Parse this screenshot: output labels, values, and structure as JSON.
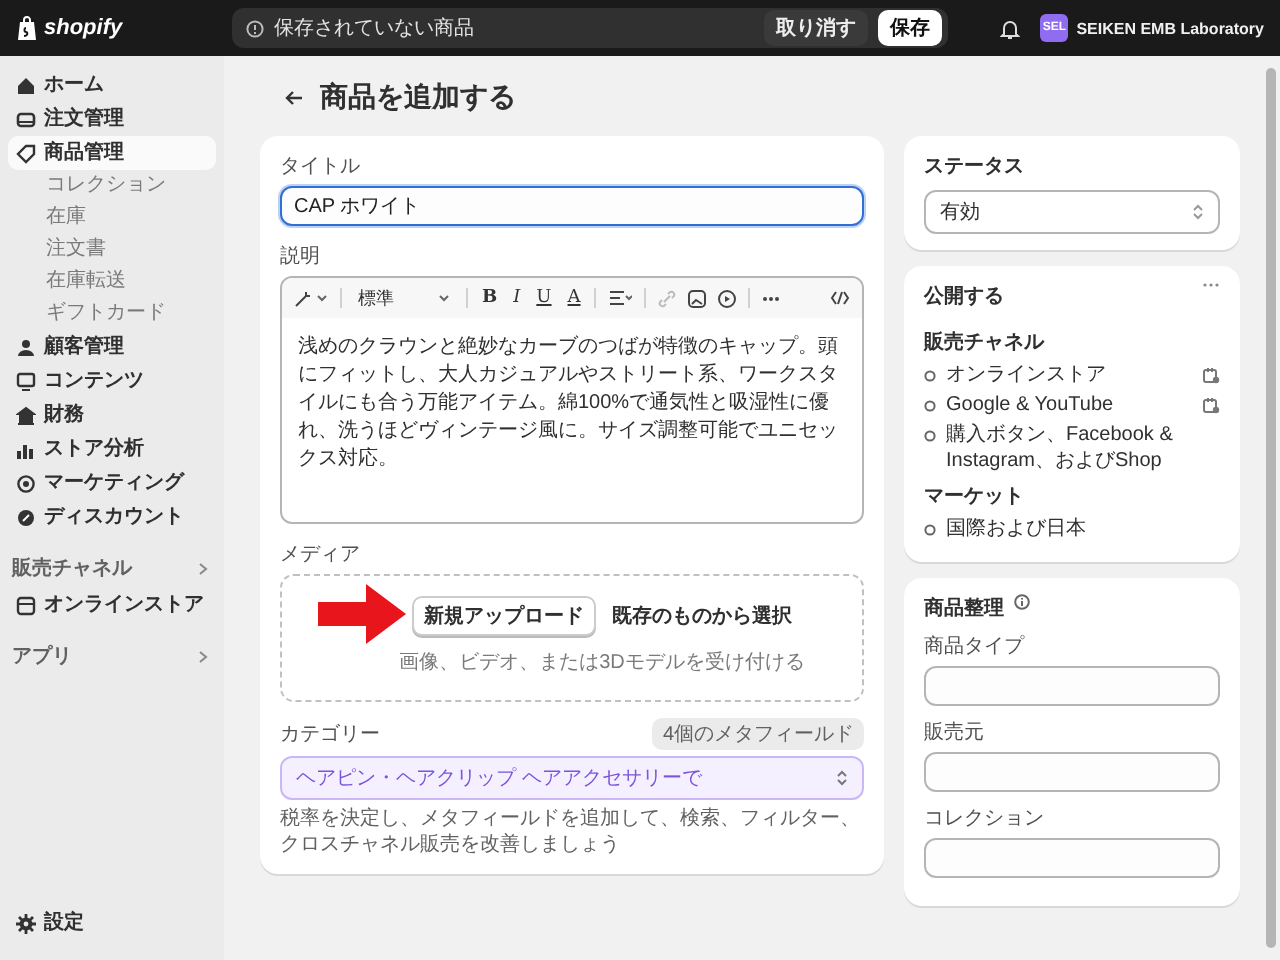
{
  "top_bar": {
    "logo": "shopify",
    "unsaved_notice": "保存されていない商品",
    "buttons": [
      {
        "label": "取り消す",
        "kind": "secondary"
      },
      {
        "label": "保存",
        "kind": "primary"
      }
    ],
    "account": {
      "initials": "SEL",
      "name": "SEIKEN EMB Laboratory"
    }
  },
  "sidebar": {
    "items": [
      {
        "label": "ホーム",
        "selected": false
      },
      {
        "label": "注文管理",
        "selected": false
      },
      {
        "label": "商品管理",
        "selected": true,
        "children": [
          {
            "label": "コレクション",
            "selected": false
          },
          {
            "label": "在庫",
            "selected": false
          },
          {
            "label": "注文書",
            "selected": false
          },
          {
            "label": "在庫転送",
            "selected": false
          },
          {
            "label": "ギフトカード",
            "selected": false
          }
        ]
      },
      {
        "label": "顧客管理",
        "selected": false
      },
      {
        "label": "コンテンツ",
        "selected": false
      },
      {
        "label": "財務",
        "selected": false
      },
      {
        "label": "ストア分析",
        "selected": false
      },
      {
        "label": "マーケティング",
        "selected": false
      },
      {
        "label": "ディスカウント",
        "selected": false
      }
    ],
    "sections": [
      {
        "label": "販売チャネル",
        "items": [
          {
            "label": "オンラインストア",
            "selected": false
          }
        ]
      },
      {
        "label": "アプリ"
      }
    ],
    "settings": "設定"
  },
  "page_title": "商品を追加する",
  "product": {
    "title_field": {
      "label": "タイトル",
      "value": "CAP ホワイト",
      "focused": true
    },
    "description": {
      "label": "説明",
      "format": "標準",
      "format_buttons": [
        "B",
        "I",
        "U",
        "A"
      ],
      "text": "浅めのクラウンと絶妙なカーブのつばが特徴のキャップ。頭にフィットし、大人カジュアルやストリート系、ワークスタイルにも合う万能アイテム。綿100%で通気性と吸湿性に優れ、洗うほどヴィンテージ風に。サイズ調整可能でユニセックス対応。"
    },
    "media": {
      "label": "メディア",
      "upload_button": "新規アップロード",
      "select_link": "既存のものから選択",
      "hint": "画像、ビデオ、または3Dモデルを受け付ける"
    },
    "category": {
      "label": "カテゴリー",
      "badge": "4個のメタフィールド",
      "value": "ヘアピン・ヘアクリップ ヘアアクセサリーで",
      "hint": "税率を決定し、メタフィールドを追加して、検索、フィルター、クロスチャネル販売を改善しましょう"
    }
  },
  "status": {
    "label": "ステータス",
    "value": "有効"
  },
  "publishing": {
    "title": "公開する",
    "channels_label": "販売チャネル",
    "channels": [
      {
        "label": "オンラインストア",
        "kind": "linked"
      },
      {
        "label": "Google & YouTube",
        "kind": "linked"
      },
      {
        "label": "購入ボタン、Facebook & Instagram、およびShop",
        "kind": "plain"
      }
    ],
    "markets_label": "マーケット",
    "markets": [
      "国際および日本"
    ]
  },
  "organization": {
    "title": "商品整理",
    "fields": [
      {
        "label": "商品タイプ"
      },
      {
        "label": "販売元"
      },
      {
        "label": "コレクション"
      }
    ]
  }
}
